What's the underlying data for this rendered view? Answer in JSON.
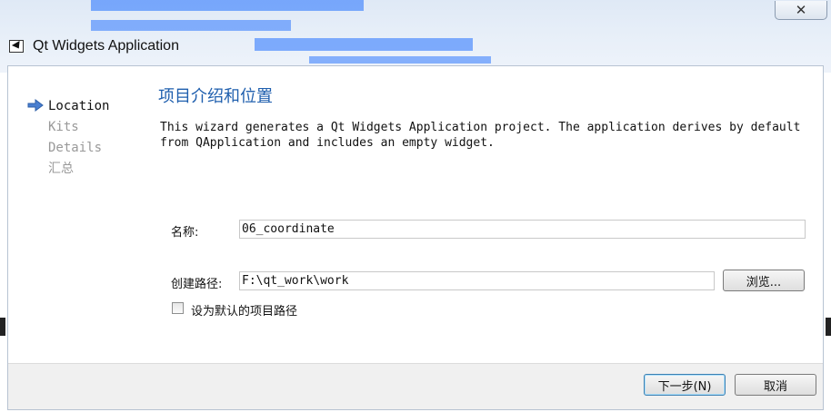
{
  "window": {
    "title": "Qt Widgets Application",
    "close_glyph": "✕"
  },
  "sidebar": {
    "items": [
      {
        "label": "Location",
        "active": true
      },
      {
        "label": "Kits",
        "active": false
      },
      {
        "label": "Details",
        "active": false
      },
      {
        "label": "汇总",
        "active": false
      }
    ]
  },
  "main": {
    "title": "项目介绍和位置",
    "description_line1": "This wizard generates a Qt Widgets Application project. The application derives by default",
    "description_line2": "from QApplication and includes an empty widget.",
    "name_label": "名称:",
    "name_value": "06_coordinate",
    "path_label": "创建路径:",
    "path_value": "F:\\qt_work\\work",
    "browse_label": "浏览...",
    "default_checkbox_label": "设为默认的项目路径",
    "default_checkbox_checked": false
  },
  "footer": {
    "next_label": "下一步(N)",
    "cancel_label": "取消"
  },
  "colors": {
    "title_blue": "#1f5fae",
    "arrow_blue": "#4a7fd0"
  }
}
